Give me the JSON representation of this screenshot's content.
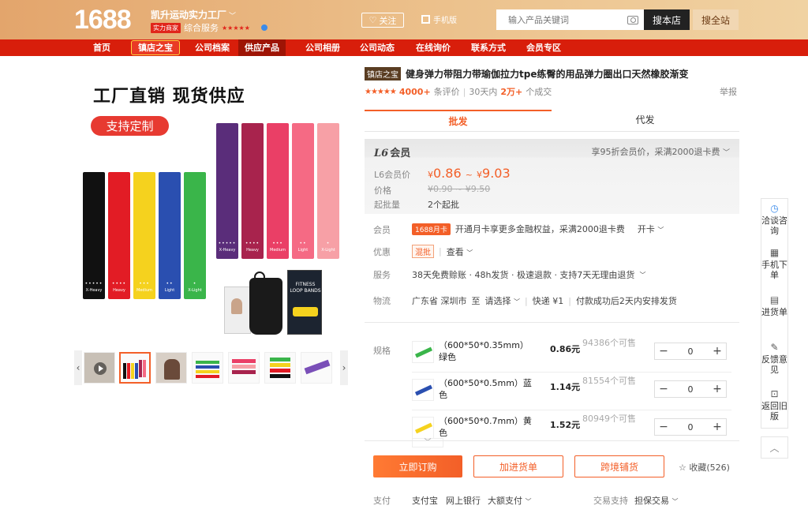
{
  "header": {
    "logo": "1688",
    "shop_name": "凯升运动实力工厂",
    "shop_badge": "实力商家",
    "shop_service": "综合服务",
    "service_stars": "★★★★★",
    "follow_label": "关注",
    "mobile_label": "手机版",
    "search_placeholder": "输入产品关键词",
    "search_shop_label": "搜本店",
    "search_all_label": "搜全站"
  },
  "nav": {
    "items": [
      "首页",
      "镇店之宝",
      "公司档案",
      "供应产品",
      "公司相册",
      "公司动态",
      "在线询价",
      "联系方式",
      "会员专区"
    ],
    "active": "供应产品"
  },
  "gallery": {
    "headline": "工厂直销  现货供应",
    "custom_label": "支持定制",
    "strength_labels": [
      "X-Heavy",
      "Heavy",
      "Medium",
      "Light",
      "X-Light"
    ],
    "long_labels": [
      "X-Heavy",
      "Heavy",
      "Medium",
      "Light",
      "X-Light"
    ],
    "package_text": "FITNESS LOOP BANDS",
    "arrow_left": "‹",
    "arrow_right": "›"
  },
  "product": {
    "tag": "镇店之宝",
    "title": "健身弹力带阻力带瑜伽拉力tpe练臀的用品弹力圈出口天然橡胶渐变",
    "stars": "★★★★★",
    "reviews_count": "4000+",
    "reviews_label": "条评价",
    "period_label": "30天内",
    "deals_count": "2万+",
    "deals_label": "个成交",
    "report_label": "举报"
  },
  "tabs": {
    "wholesale": "批发",
    "dropship": "代发"
  },
  "price": {
    "level": "L6",
    "level_label": "会员",
    "member_discount": "享95折会员价，采满2000退卡费",
    "price_label": "L6会员价",
    "currency": "¥",
    "low": "0.86",
    "sep": "~",
    "high": "9.03",
    "original_label": "价格",
    "original": "¥0.90 ~ ¥9.50",
    "moq_label": "起批量",
    "moq": "2个起批"
  },
  "info": {
    "member_label": "会员",
    "card_tag": "1688月卡",
    "member_text": "开通月卡享更多金融权益，采满2000退卡费",
    "open_card": "开卡",
    "discount_label": "优惠",
    "discount_tag": "混批",
    "discount_view": "查看",
    "service_label": "服务",
    "service_text": "38天免费赊账 · 48h发货 · 极速退款 · 支持7天无理由退货",
    "logistics_label": "物流",
    "logistics_from": "广东省 深圳市",
    "logistics_to_label": "至",
    "logistics_to": "请选择",
    "logistics_express": "快递 ¥1",
    "logistics_note": "付款成功后2天内安排发货"
  },
  "sku": {
    "label": "规格",
    "rows": [
      {
        "name": "（600*50*0.35mm）绿色",
        "price": "0.86元",
        "stock": "94386个可售",
        "qty": "0",
        "color": "#3ab54a"
      },
      {
        "name": "（600*50*0.5mm）蓝色",
        "price": "1.14元",
        "stock": "81554个可售",
        "qty": "0",
        "color": "#2a4fb0"
      },
      {
        "name": "（600*50*0.7mm）黄色",
        "price": "1.52元",
        "stock": "80949个可售",
        "qty": "0",
        "color": "#f5d21e"
      }
    ],
    "minus": "−",
    "plus": "+"
  },
  "actions": {
    "order": "立即订购",
    "cart": "加进货单",
    "cross_border": "跨境铺货",
    "favorite": "收藏(526)"
  },
  "payment": {
    "label": "支付",
    "methods": [
      "支付宝",
      "网上银行",
      "大额支付"
    ],
    "trade_label": "交易支持",
    "trade_value": "担保交易"
  },
  "sidebar": {
    "items": [
      "洽谈咨询",
      "手机下单",
      "进货单",
      "反馈意见",
      "返回旧版"
    ]
  },
  "colors": {
    "brand_orange": "#f35f28",
    "nav_red": "#d81e0b"
  }
}
